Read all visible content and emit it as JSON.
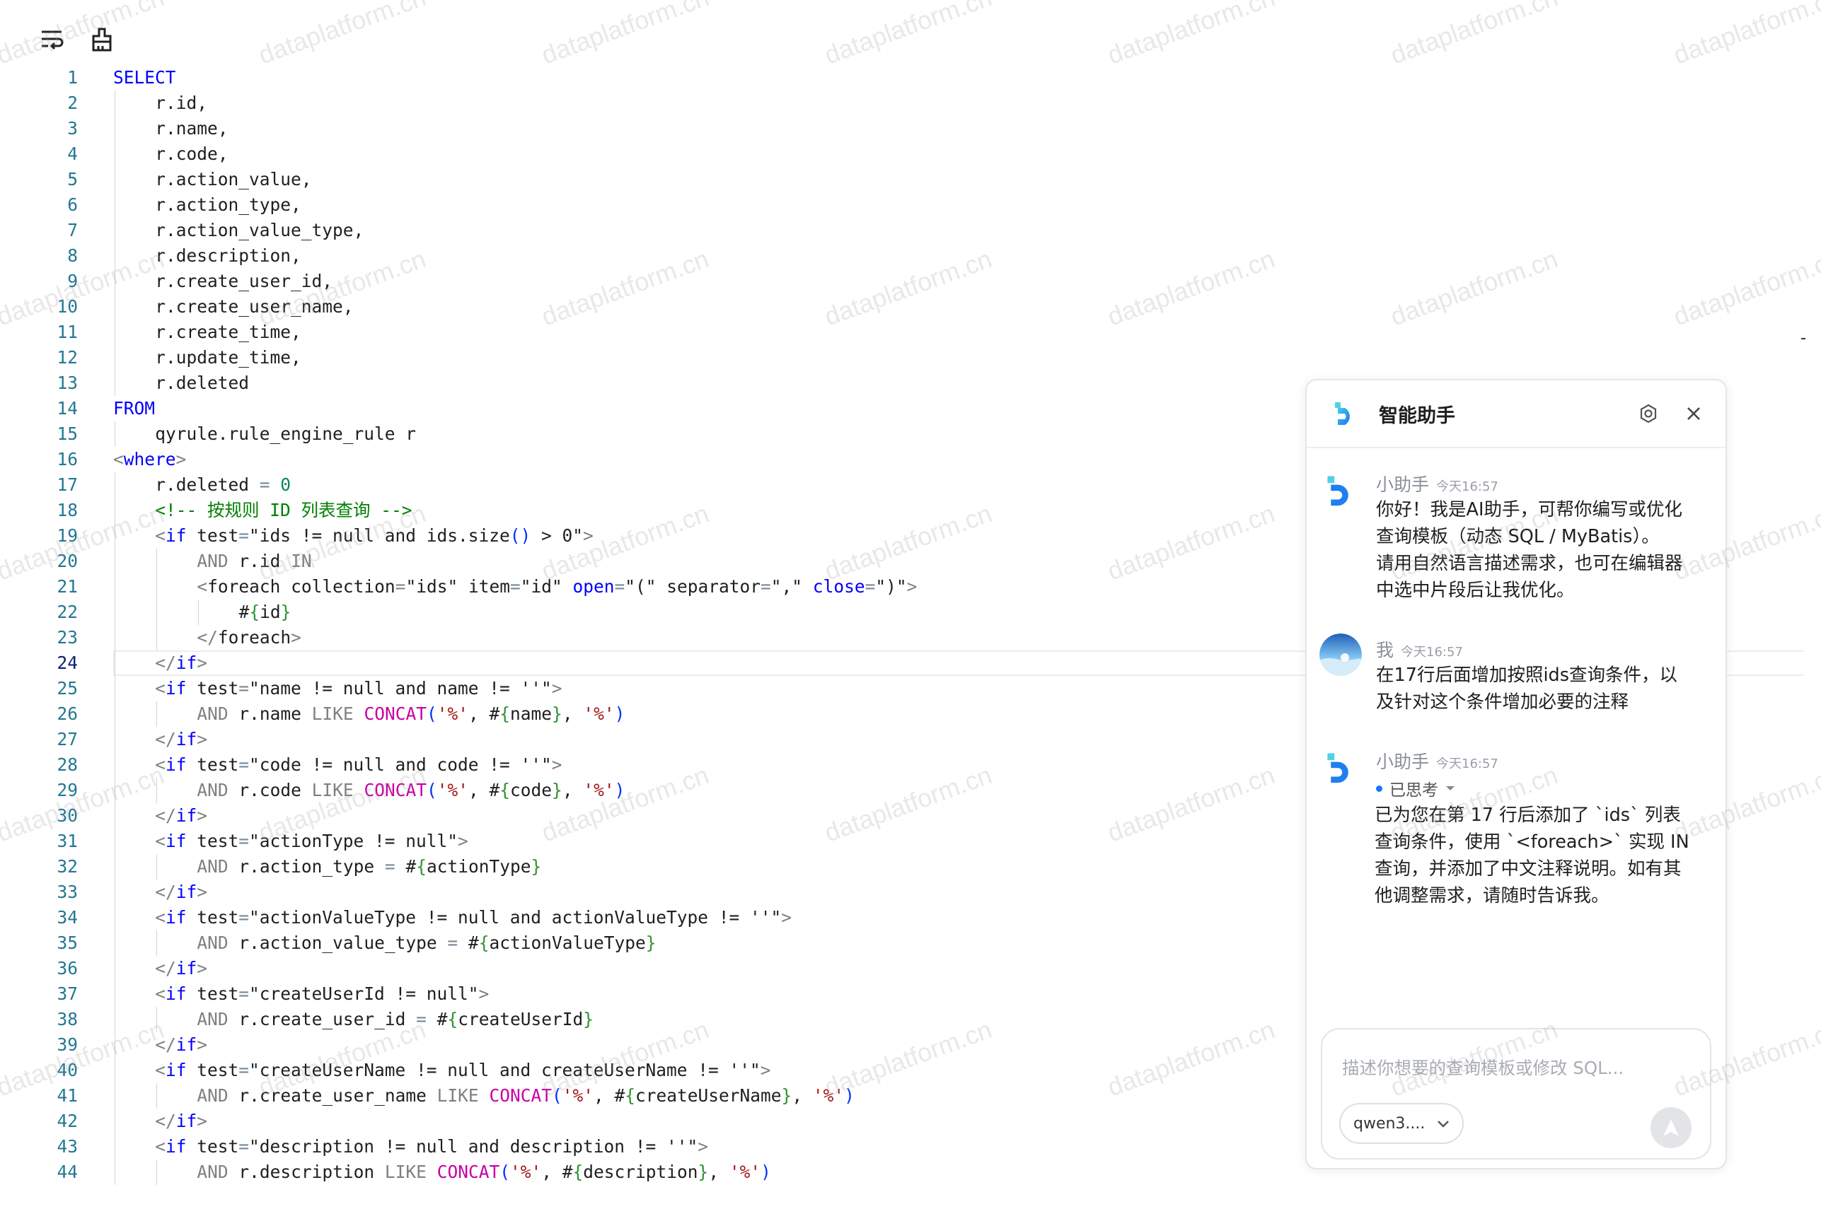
{
  "toolbar": {
    "wrap_icon": "text-wrap-icon",
    "format_icon": "format-brush-icon"
  },
  "editor": {
    "current_line": 24,
    "lines": [
      {
        "n": "1",
        "indent": 0,
        "tokens": [
          [
            "kw",
            "SELECT"
          ]
        ]
      },
      {
        "n": "2",
        "indent": 1,
        "tokens": [
          [
            "p",
            "r.id,"
          ]
        ]
      },
      {
        "n": "3",
        "indent": 1,
        "tokens": [
          [
            "p",
            "r.name,"
          ]
        ]
      },
      {
        "n": "4",
        "indent": 1,
        "tokens": [
          [
            "p",
            "r.code,"
          ]
        ]
      },
      {
        "n": "5",
        "indent": 1,
        "tokens": [
          [
            "p",
            "r.action_value,"
          ]
        ]
      },
      {
        "n": "6",
        "indent": 1,
        "tokens": [
          [
            "p",
            "r.action_type,"
          ]
        ]
      },
      {
        "n": "7",
        "indent": 1,
        "tokens": [
          [
            "p",
            "r.action_value_type,"
          ]
        ]
      },
      {
        "n": "8",
        "indent": 1,
        "tokens": [
          [
            "p",
            "r.description,"
          ]
        ]
      },
      {
        "n": "9",
        "indent": 1,
        "tokens": [
          [
            "p",
            "r.create_user_id,"
          ]
        ]
      },
      {
        "n": "10",
        "indent": 1,
        "tokens": [
          [
            "p",
            "r.create_user_name,"
          ]
        ]
      },
      {
        "n": "11",
        "indent": 1,
        "tokens": [
          [
            "p",
            "r.create_time,"
          ]
        ]
      },
      {
        "n": "12",
        "indent": 1,
        "tokens": [
          [
            "p",
            "r.update_time,"
          ]
        ]
      },
      {
        "n": "13",
        "indent": 1,
        "tokens": [
          [
            "p",
            "r.deleted"
          ]
        ]
      },
      {
        "n": "14",
        "indent": 0,
        "tokens": [
          [
            "kw",
            "FROM"
          ]
        ]
      },
      {
        "n": "15",
        "indent": 1,
        "tokens": [
          [
            "p",
            "qyrule.rule_engine_rule r"
          ]
        ]
      },
      {
        "n": "16",
        "indent": 0,
        "tokens": [
          [
            "gray",
            "<"
          ],
          [
            "kw",
            "where"
          ],
          [
            "gray",
            ">"
          ]
        ]
      },
      {
        "n": "17",
        "indent": 1,
        "tokens": [
          [
            "p",
            "r.deleted "
          ],
          [
            "op",
            "="
          ],
          [
            "p",
            " "
          ],
          [
            "num",
            "0"
          ]
        ]
      },
      {
        "n": "18",
        "indent": 1,
        "tokens": [
          [
            "cm",
            "<!-- 按规则 ID 列表查询 -->"
          ]
        ]
      },
      {
        "n": "19",
        "indent": 1,
        "tokens": [
          [
            "gray",
            "<"
          ],
          [
            "kw",
            "if"
          ],
          [
            "p",
            " test"
          ],
          [
            "op",
            "="
          ],
          [
            "p",
            "\"ids != null and ids.size"
          ],
          [
            "br",
            "()"
          ],
          [
            "p",
            " > 0\""
          ],
          [
            "gray",
            ">"
          ]
        ]
      },
      {
        "n": "20",
        "indent": 2,
        "tokens": [
          [
            "gray",
            "AND"
          ],
          [
            "p",
            " r.id "
          ],
          [
            "gray",
            "IN"
          ]
        ]
      },
      {
        "n": "21",
        "indent": 2,
        "tokens": [
          [
            "gray",
            "<"
          ],
          [
            "p",
            "foreach collection"
          ],
          [
            "op",
            "="
          ],
          [
            "p",
            "\"ids\" item"
          ],
          [
            "op",
            "="
          ],
          [
            "p",
            "\"id\" "
          ],
          [
            "kw",
            "open"
          ],
          [
            "op",
            "="
          ],
          [
            "p",
            "\"(\" separator"
          ],
          [
            "op",
            "="
          ],
          [
            "p",
            "\",\" "
          ],
          [
            "kw",
            "close"
          ],
          [
            "op",
            "="
          ],
          [
            "p",
            "\")\""
          ],
          [
            "gray",
            ">"
          ]
        ]
      },
      {
        "n": "22",
        "indent": 3,
        "tokens": [
          [
            "p",
            "#"
          ],
          [
            "br2",
            "{"
          ],
          [
            "p",
            "id"
          ],
          [
            "br2",
            "}"
          ]
        ]
      },
      {
        "n": "23",
        "indent": 2,
        "tokens": [
          [
            "gray",
            "</"
          ],
          [
            "p",
            "foreach"
          ],
          [
            "gray",
            ">"
          ]
        ]
      },
      {
        "n": "24",
        "indent": 1,
        "tokens": [
          [
            "gray",
            "</"
          ],
          [
            "kw",
            "if"
          ],
          [
            "gray",
            ">"
          ]
        ]
      },
      {
        "n": "25",
        "indent": 1,
        "tokens": [
          [
            "gray",
            "<"
          ],
          [
            "kw",
            "if"
          ],
          [
            "p",
            " test"
          ],
          [
            "op",
            "="
          ],
          [
            "p",
            "\"name != null and name != ''\""
          ],
          [
            "gray",
            ">"
          ]
        ]
      },
      {
        "n": "26",
        "indent": 2,
        "tokens": [
          [
            "gray",
            "AND"
          ],
          [
            "p",
            " r.name "
          ],
          [
            "gray",
            "LIKE"
          ],
          [
            "p",
            " "
          ],
          [
            "fn",
            "CONCAT"
          ],
          [
            "br",
            "("
          ],
          [
            "str",
            "'%'"
          ],
          [
            "p",
            ", #"
          ],
          [
            "br2",
            "{"
          ],
          [
            "p",
            "name"
          ],
          [
            "br2",
            "}"
          ],
          [
            "p",
            ", "
          ],
          [
            "str",
            "'%'"
          ],
          [
            "br",
            ")"
          ]
        ]
      },
      {
        "n": "27",
        "indent": 1,
        "tokens": [
          [
            "gray",
            "</"
          ],
          [
            "kw",
            "if"
          ],
          [
            "gray",
            ">"
          ]
        ]
      },
      {
        "n": "28",
        "indent": 1,
        "tokens": [
          [
            "gray",
            "<"
          ],
          [
            "kw",
            "if"
          ],
          [
            "p",
            " test"
          ],
          [
            "op",
            "="
          ],
          [
            "p",
            "\"code != null and code != ''\""
          ],
          [
            "gray",
            ">"
          ]
        ]
      },
      {
        "n": "29",
        "indent": 2,
        "tokens": [
          [
            "gray",
            "AND"
          ],
          [
            "p",
            " r.code "
          ],
          [
            "gray",
            "LIKE"
          ],
          [
            "p",
            " "
          ],
          [
            "fn",
            "CONCAT"
          ],
          [
            "br",
            "("
          ],
          [
            "str",
            "'%'"
          ],
          [
            "p",
            ", #"
          ],
          [
            "br2",
            "{"
          ],
          [
            "p",
            "code"
          ],
          [
            "br2",
            "}"
          ],
          [
            "p",
            ", "
          ],
          [
            "str",
            "'%'"
          ],
          [
            "br",
            ")"
          ]
        ]
      },
      {
        "n": "30",
        "indent": 1,
        "tokens": [
          [
            "gray",
            "</"
          ],
          [
            "kw",
            "if"
          ],
          [
            "gray",
            ">"
          ]
        ]
      },
      {
        "n": "31",
        "indent": 1,
        "tokens": [
          [
            "gray",
            "<"
          ],
          [
            "kw",
            "if"
          ],
          [
            "p",
            " test"
          ],
          [
            "op",
            "="
          ],
          [
            "p",
            "\"actionType != null\""
          ],
          [
            "gray",
            ">"
          ]
        ]
      },
      {
        "n": "32",
        "indent": 2,
        "tokens": [
          [
            "gray",
            "AND"
          ],
          [
            "p",
            " r.action_type "
          ],
          [
            "op",
            "="
          ],
          [
            "p",
            " #"
          ],
          [
            "br2",
            "{"
          ],
          [
            "p",
            "actionType"
          ],
          [
            "br2",
            "}"
          ]
        ]
      },
      {
        "n": "33",
        "indent": 1,
        "tokens": [
          [
            "gray",
            "</"
          ],
          [
            "kw",
            "if"
          ],
          [
            "gray",
            ">"
          ]
        ]
      },
      {
        "n": "34",
        "indent": 1,
        "tokens": [
          [
            "gray",
            "<"
          ],
          [
            "kw",
            "if"
          ],
          [
            "p",
            " test"
          ],
          [
            "op",
            "="
          ],
          [
            "p",
            "\"actionValueType != null and actionValueType != ''\""
          ],
          [
            "gray",
            ">"
          ]
        ]
      },
      {
        "n": "35",
        "indent": 2,
        "tokens": [
          [
            "gray",
            "AND"
          ],
          [
            "p",
            " r.action_value_type "
          ],
          [
            "op",
            "="
          ],
          [
            "p",
            " #"
          ],
          [
            "br2",
            "{"
          ],
          [
            "p",
            "actionValueType"
          ],
          [
            "br2",
            "}"
          ]
        ]
      },
      {
        "n": "36",
        "indent": 1,
        "tokens": [
          [
            "gray",
            "</"
          ],
          [
            "kw",
            "if"
          ],
          [
            "gray",
            ">"
          ]
        ]
      },
      {
        "n": "37",
        "indent": 1,
        "tokens": [
          [
            "gray",
            "<"
          ],
          [
            "kw",
            "if"
          ],
          [
            "p",
            " test"
          ],
          [
            "op",
            "="
          ],
          [
            "p",
            "\"createUserId != null\""
          ],
          [
            "gray",
            ">"
          ]
        ]
      },
      {
        "n": "38",
        "indent": 2,
        "tokens": [
          [
            "gray",
            "AND"
          ],
          [
            "p",
            " r.create_user_id "
          ],
          [
            "op",
            "="
          ],
          [
            "p",
            " #"
          ],
          [
            "br2",
            "{"
          ],
          [
            "p",
            "createUserId"
          ],
          [
            "br2",
            "}"
          ]
        ]
      },
      {
        "n": "39",
        "indent": 1,
        "tokens": [
          [
            "gray",
            "</"
          ],
          [
            "kw",
            "if"
          ],
          [
            "gray",
            ">"
          ]
        ]
      },
      {
        "n": "40",
        "indent": 1,
        "tokens": [
          [
            "gray",
            "<"
          ],
          [
            "kw",
            "if"
          ],
          [
            "p",
            " test"
          ],
          [
            "op",
            "="
          ],
          [
            "p",
            "\"createUserName != null and createUserName != ''\""
          ],
          [
            "gray",
            ">"
          ]
        ]
      },
      {
        "n": "41",
        "indent": 2,
        "tokens": [
          [
            "gray",
            "AND"
          ],
          [
            "p",
            " r.create_user_name "
          ],
          [
            "gray",
            "LIKE"
          ],
          [
            "p",
            " "
          ],
          [
            "fn",
            "CONCAT"
          ],
          [
            "br",
            "("
          ],
          [
            "str",
            "'%'"
          ],
          [
            "p",
            ", #"
          ],
          [
            "br2",
            "{"
          ],
          [
            "p",
            "createUserName"
          ],
          [
            "br2",
            "}"
          ],
          [
            "p",
            ", "
          ],
          [
            "str",
            "'%'"
          ],
          [
            "br",
            ")"
          ]
        ]
      },
      {
        "n": "42",
        "indent": 1,
        "tokens": [
          [
            "gray",
            "</"
          ],
          [
            "kw",
            "if"
          ],
          [
            "gray",
            ">"
          ]
        ]
      },
      {
        "n": "43",
        "indent": 1,
        "tokens": [
          [
            "gray",
            "<"
          ],
          [
            "kw",
            "if"
          ],
          [
            "p",
            " test"
          ],
          [
            "op",
            "="
          ],
          [
            "p",
            "\"description != null and description != ''\""
          ],
          [
            "gray",
            ">"
          ]
        ]
      },
      {
        "n": "44",
        "indent": 2,
        "tokens": [
          [
            "gray",
            "AND"
          ],
          [
            "p",
            " r.description "
          ],
          [
            "gray",
            "LIKE"
          ],
          [
            "p",
            " "
          ],
          [
            "fn",
            "CONCAT"
          ],
          [
            "br",
            "("
          ],
          [
            "str",
            "'%'"
          ],
          [
            "p",
            ", #"
          ],
          [
            "br2",
            "{"
          ],
          [
            "p",
            "description"
          ],
          [
            "br2",
            "}"
          ],
          [
            "p",
            ", "
          ],
          [
            "str",
            "'%'"
          ],
          [
            "br",
            ")"
          ]
        ]
      }
    ]
  },
  "watermark": "dataplatform.cn",
  "assistant": {
    "title": "智能助手",
    "settings_icon": "settings-icon",
    "close_icon": "close-icon",
    "messages": [
      {
        "sender": "小助手",
        "time": "今天16:57",
        "avatar": "assistant-logo",
        "text": "你好！我是AI助手，可帮你编写或优化\n查询模板（动态 SQL / MyBatis）。\n请用自然语言描述需求，也可在编辑器\n中选中片段后让我优化。"
      },
      {
        "sender": "我",
        "time": "今天16:57",
        "avatar": "user-avatar",
        "text": "在17行后面增加按照ids查询条件，以\n及针对这个条件增加必要的注释"
      },
      {
        "sender": "小助手",
        "time": "今天16:57",
        "avatar": "assistant-logo",
        "thought_label": "已思考",
        "text": "已为您在第 17 行后添加了 `ids` 列表\n查询条件，使用 `<foreach>` 实现 IN\n查询，并添加了中文注释说明。如有其\n他调整需求，请随时告诉我。"
      }
    ],
    "input_placeholder": "描述你想要的查询模板或修改 SQL...",
    "model_selected": "qwen3....",
    "send_icon": "send-icon"
  }
}
